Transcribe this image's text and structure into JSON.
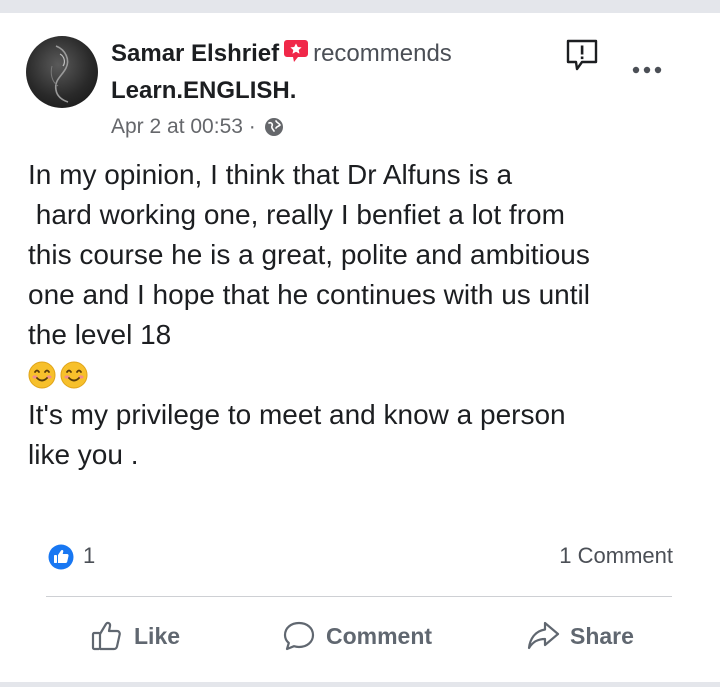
{
  "post": {
    "author": "Samar Elshrief",
    "action": "recommends",
    "page": "Learn.ENGLISH.",
    "timestamp": "Apr 2 at 00:53",
    "separator": "·",
    "privacy_icon": "globe-icon",
    "text_lines": [
      "In my opinion, I  think that Dr Alfuns is a",
      " hard working one, really I benfiet a lot from",
      "this course he is a great, polite and ambitious",
      "one and I hope that he continues with us until",
      "the level 18"
    ],
    "emojis": [
      "😊",
      "😊"
    ],
    "text_lines_2": [
      "It's my privilege to meet and know a person",
      "like you ."
    ]
  },
  "stats": {
    "like_count": "1",
    "comment_count": "1 Comment"
  },
  "actions": {
    "like_label": "Like",
    "comment_label": "Comment",
    "share_label": "Share"
  },
  "colors": {
    "like_blue": "#1877f2",
    "recommend_red": "#f02849",
    "muted_text": "#65676b",
    "action_gray": "#606770"
  }
}
